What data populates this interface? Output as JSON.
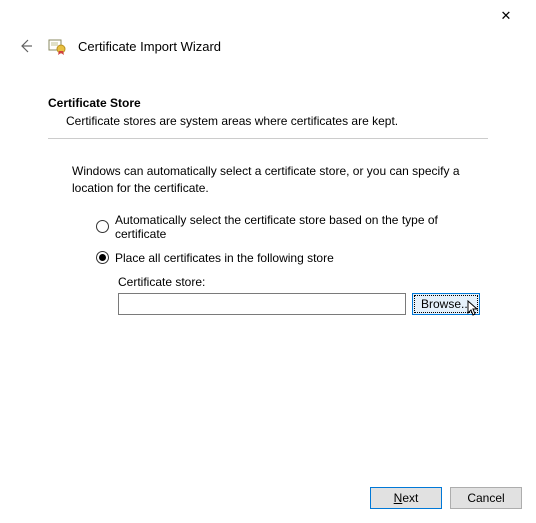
{
  "window": {
    "close_label": "✕"
  },
  "header": {
    "title": "Certificate Import Wizard"
  },
  "section": {
    "title": "Certificate Store",
    "description": "Certificate stores are system areas where certificates are kept."
  },
  "instruction": "Windows can automatically select a certificate store, or you can specify a location for the certificate.",
  "radios": {
    "auto": {
      "label": "Automatically select the certificate store based on the type of certificate",
      "selected": false
    },
    "manual": {
      "label": "Place all certificates in the following store",
      "selected": true
    }
  },
  "store": {
    "label": "Certificate store:",
    "value": "",
    "browse_label": "Browse..."
  },
  "footer": {
    "next_prefix": "N",
    "next_rest": "ext",
    "cancel": "Cancel"
  }
}
